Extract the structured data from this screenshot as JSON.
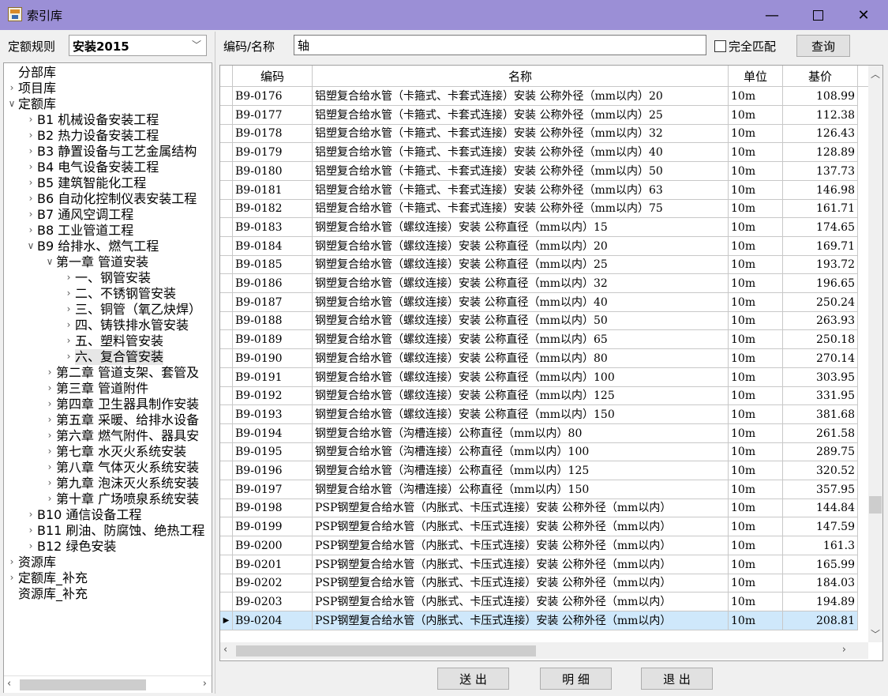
{
  "window": {
    "title": "索引库"
  },
  "left": {
    "rule_label": "定额规则",
    "rule_value": "安装2015",
    "tree": [
      {
        "label": "分部库",
        "level": 0,
        "arrow": ""
      },
      {
        "label": "项目库",
        "level": 0,
        "arrow": "right"
      },
      {
        "label": "定额库",
        "level": 0,
        "arrow": "down"
      },
      {
        "label": "B1 机械设备安装工程",
        "level": 1,
        "arrow": "right"
      },
      {
        "label": "B2 热力设备安装工程",
        "level": 1,
        "arrow": "right"
      },
      {
        "label": "B3 静置设备与工艺金属结构",
        "level": 1,
        "arrow": "right"
      },
      {
        "label": "B4 电气设备安装工程",
        "level": 1,
        "arrow": "right"
      },
      {
        "label": "B5 建筑智能化工程",
        "level": 1,
        "arrow": "right"
      },
      {
        "label": "B6 自动化控制仪表安装工程",
        "level": 1,
        "arrow": "right"
      },
      {
        "label": "B7 通风空调工程",
        "level": 1,
        "arrow": "right"
      },
      {
        "label": "B8 工业管道工程",
        "level": 1,
        "arrow": "right"
      },
      {
        "label": "B9 给排水、燃气工程",
        "level": 1,
        "arrow": "down"
      },
      {
        "label": "第一章 管道安装",
        "level": 2,
        "arrow": "down"
      },
      {
        "label": "一、钢管安装",
        "level": 3,
        "arrow": "right"
      },
      {
        "label": "二、不锈钢管安装",
        "level": 3,
        "arrow": "right"
      },
      {
        "label": "三、铜管（氧乙炔焊）",
        "level": 3,
        "arrow": "right"
      },
      {
        "label": "四、铸铁排水管安装",
        "level": 3,
        "arrow": "right"
      },
      {
        "label": "五、塑料管安装",
        "level": 3,
        "arrow": "right"
      },
      {
        "label": "六、复合管安装",
        "level": 3,
        "arrow": "right",
        "selected": true
      },
      {
        "label": "第二章 管道支架、套管及",
        "level": 2,
        "arrow": "right"
      },
      {
        "label": "第三章 管道附件",
        "level": 2,
        "arrow": "right"
      },
      {
        "label": "第四章 卫生器具制作安装",
        "level": 2,
        "arrow": "right"
      },
      {
        "label": "第五章 采暖、给排水设备",
        "level": 2,
        "arrow": "right"
      },
      {
        "label": "第六章 燃气附件、器具安",
        "level": 2,
        "arrow": "right"
      },
      {
        "label": "第七章 水灭火系统安装",
        "level": 2,
        "arrow": "right"
      },
      {
        "label": "第八章 气体灭火系统安装",
        "level": 2,
        "arrow": "right"
      },
      {
        "label": "第九章 泡沫灭火系统安装",
        "level": 2,
        "arrow": "right"
      },
      {
        "label": "第十章 广场喷泉系统安装",
        "level": 2,
        "arrow": "right"
      },
      {
        "label": "B10 通信设备工程",
        "level": 1,
        "arrow": "right"
      },
      {
        "label": "B11 刷油、防腐蚀、绝热工程",
        "level": 1,
        "arrow": "right"
      },
      {
        "label": "B12 绿色安装",
        "level": 1,
        "arrow": "right"
      },
      {
        "label": "资源库",
        "level": 0,
        "arrow": "right"
      },
      {
        "label": "定额库_补充",
        "level": 0,
        "arrow": "right"
      },
      {
        "label": "资源库_补充",
        "level": 0,
        "arrow": ""
      }
    ]
  },
  "search": {
    "label": "编码/名称",
    "value": "轴",
    "exact_match_label": "完全匹配",
    "query_button": "查询"
  },
  "table": {
    "columns": [
      "编码",
      "名称",
      "单位",
      "基价"
    ],
    "rows": [
      [
        "B9-0176",
        "铝塑复合给水管（卡箍式、卡套式连接）安装 公称外径（mm以内）20",
        "10m",
        "108.99"
      ],
      [
        "B9-0177",
        "铝塑复合给水管（卡箍式、卡套式连接）安装 公称外径（mm以内）25",
        "10m",
        "112.38"
      ],
      [
        "B9-0178",
        "铝塑复合给水管（卡箍式、卡套式连接）安装 公称外径（mm以内）32",
        "10m",
        "126.43"
      ],
      [
        "B9-0179",
        "铝塑复合给水管（卡箍式、卡套式连接）安装 公称外径（mm以内）40",
        "10m",
        "128.89"
      ],
      [
        "B9-0180",
        "铝塑复合给水管（卡箍式、卡套式连接）安装 公称外径（mm以内）50",
        "10m",
        "137.73"
      ],
      [
        "B9-0181",
        "铝塑复合给水管（卡箍式、卡套式连接）安装 公称外径（mm以内）63",
        "10m",
        "146.98"
      ],
      [
        "B9-0182",
        "铝塑复合给水管（卡箍式、卡套式连接）安装 公称外径（mm以内）75",
        "10m",
        "161.71"
      ],
      [
        "B9-0183",
        "钢塑复合给水管（螺纹连接）安装 公称直径（mm以内）15",
        "10m",
        "174.65"
      ],
      [
        "B9-0184",
        "钢塑复合给水管（螺纹连接）安装 公称直径（mm以内）20",
        "10m",
        "169.71"
      ],
      [
        "B9-0185",
        "钢塑复合给水管（螺纹连接）安装 公称直径（mm以内）25",
        "10m",
        "193.72"
      ],
      [
        "B9-0186",
        "钢塑复合给水管（螺纹连接）安装 公称直径（mm以内）32",
        "10m",
        "196.65"
      ],
      [
        "B9-0187",
        "钢塑复合给水管（螺纹连接）安装 公称直径（mm以内）40",
        "10m",
        "250.24"
      ],
      [
        "B9-0188",
        "钢塑复合给水管（螺纹连接）安装 公称直径（mm以内）50",
        "10m",
        "263.93"
      ],
      [
        "B9-0189",
        "钢塑复合给水管（螺纹连接）安装 公称直径（mm以内）65",
        "10m",
        "250.18"
      ],
      [
        "B9-0190",
        "钢塑复合给水管（螺纹连接）安装 公称直径（mm以内）80",
        "10m",
        "270.14"
      ],
      [
        "B9-0191",
        "钢塑复合给水管（螺纹连接）安装 公称直径（mm以内）100",
        "10m",
        "303.95"
      ],
      [
        "B9-0192",
        "钢塑复合给水管（螺纹连接）安装 公称直径（mm以内）125",
        "10m",
        "331.95"
      ],
      [
        "B9-0193",
        "钢塑复合给水管（螺纹连接）安装 公称直径（mm以内）150",
        "10m",
        "381.68"
      ],
      [
        "B9-0194",
        "钢塑复合给水管（沟槽连接）公称直径（mm以内）80",
        "10m",
        "261.58"
      ],
      [
        "B9-0195",
        "钢塑复合给水管（沟槽连接）公称直径（mm以内）100",
        "10m",
        "289.75"
      ],
      [
        "B9-0196",
        "钢塑复合给水管（沟槽连接）公称直径（mm以内）125",
        "10m",
        "320.52"
      ],
      [
        "B9-0197",
        "钢塑复合给水管（沟槽连接）公称直径（mm以内）150",
        "10m",
        "357.95"
      ],
      [
        "B9-0198",
        "PSP钢塑复合给水管（内胀式、卡压式连接）安装 公称外径（mm以内）",
        "10m",
        "144.84"
      ],
      [
        "B9-0199",
        "PSP钢塑复合给水管（内胀式、卡压式连接）安装 公称外径（mm以内）",
        "10m",
        "147.59"
      ],
      [
        "B9-0200",
        "PSP钢塑复合给水管（内胀式、卡压式连接）安装 公称外径（mm以内）",
        "10m",
        "161.3"
      ],
      [
        "B9-0201",
        "PSP钢塑复合给水管（内胀式、卡压式连接）安装 公称外径（mm以内）",
        "10m",
        "165.99"
      ],
      [
        "B9-0202",
        "PSP钢塑复合给水管（内胀式、卡压式连接）安装 公称外径（mm以内）",
        "10m",
        "184.03"
      ],
      [
        "B9-0203",
        "PSP钢塑复合给水管（内胀式、卡压式连接）安装 公称外径（mm以内）",
        "10m",
        "194.89"
      ],
      [
        "B9-0204",
        "PSP钢塑复合给水管（内胀式、卡压式连接）安装 公称外径（mm以内）",
        "10m",
        "208.81"
      ]
    ],
    "selected_row": 28
  },
  "buttons": {
    "send": "送 出",
    "detail": "明 细",
    "exit": "退 出"
  },
  "colors": {
    "titlebar": "#9b8fd6",
    "selected_row": "#cfe8fb"
  }
}
